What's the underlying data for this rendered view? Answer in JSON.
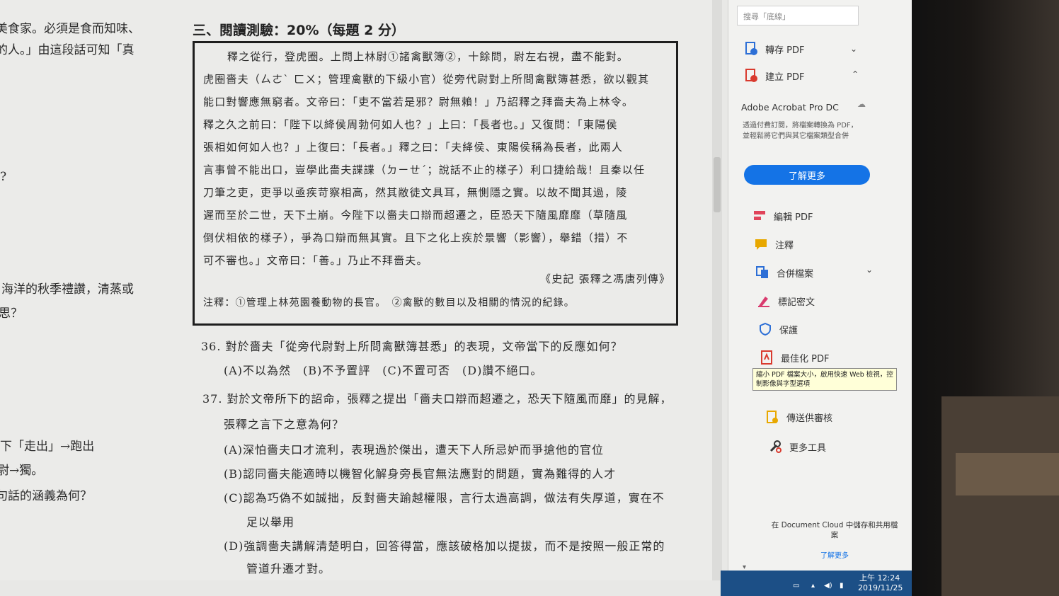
{
  "doc": {
    "left_fragments": [
      "美食家。必須是食而知味、",
      "的人。」由這段話可知「真",
      "?",
      "海洋的秋季禮讚，清蒸或",
      "思？",
      "下「走出」→跑出",
      "尉→獨。",
      "句話的涵義為何？"
    ],
    "section_heading": "三、閱讀測驗：20%（每題 2 分）",
    "passage_lines": [
      "釋之從行，登虎圈。上問上林尉①諸禽獸簿②，十餘問，尉左右視，盡不能對。",
      "虎圈嗇夫（ㄙㄜˋ ㄈㄨ；管理禽獸的下級小官）從旁代尉對上所問禽獸簿甚悉，欲以觀其",
      "能口對響應無窮者。文帝曰：「吏不當若是邪？尉無賴！」乃詔釋之拜嗇夫為上林令。",
      "釋之久之前曰：「陛下以絳侯周勃何如人也？」上曰：「長者也。」又復問：「東陽侯",
      "張相如何如人也？」上復曰：「長者。」釋之曰：「夫絳侯、東陽侯稱為長者，此兩人",
      "言事曾不能出口，豈學此嗇夫諜諜（ㄉㄧㄝˊ；說話不止的樣子）利口捷給哉！且秦以任",
      "刀筆之吏，吏爭以亟疾苛察相高，然其敝徒文具耳，無惻隱之實。以故不聞其過，陵",
      "遲而至於二世，天下土崩。今陛下以嗇夫口辯而超遷之，臣恐天下隨風靡靡（草隨風",
      "倒伏相依的樣子），爭為口辯而無其實。且下之化上疾於景響（影響），舉錯（措）不",
      "可不審也。」文帝曰：「善。」乃止不拜嗇夫。"
    ],
    "source": "《史記 張釋之馮唐列傳》",
    "notes": "注釋：①管理上林苑園養動物的長官。　②禽獸的數目以及相關的情況的紀錄。",
    "questions": [
      "36. 對於嗇夫「從旁代尉對上所問禽獸簿甚悉」的表現，文帝當下的反應如何？",
      "(A)不以為然　(B)不予置評　(C)不置可否　(D)讚不絕口。",
      "37. 對於文帝所下的詔命，張釋之提出「嗇夫口辯而超遷之，恐天下隨風而靡」的見解，",
      "張釋之言下之意為何？",
      "(A)深怕嗇夫口才流利，表現過於傑出，遭天下人所忌妒而爭搶他的官位",
      "(B)認同嗇夫能適時以機智化解身旁長官無法應對的問題，實為難得的人才",
      "(C)認為巧偽不如誠拙，反對嗇夫踰越權限，言行太過高調，做法有失厚道，實在不",
      "足以舉用",
      "(D)強調嗇夫講解清楚明白，回答得當，應該破格加以提拔，而不是按照一般正常的",
      "管道升遷才對。"
    ]
  },
  "panel": {
    "search_placeholder": "搜尋「底線」",
    "tools_top": [
      {
        "label": "轉存 PDF",
        "icon": "export-pdf-icon",
        "color": "#2d6fd6"
      },
      {
        "label": "建立 PDF",
        "icon": "create-pdf-icon",
        "color": "#d93a2e"
      }
    ],
    "acrobat_title": "Adobe Acrobat Pro DC",
    "acrobat_desc": "透過付費訂閱，將檔案轉換為 PDF，並輕鬆將它們與其它檔案類型合併",
    "learn_more": "了解更多",
    "tools": [
      {
        "label": "編輯 PDF",
        "icon": "edit-pdf-icon",
        "color": "#e0445a"
      },
      {
        "label": "注釋",
        "icon": "comment-icon",
        "color": "#e8a800"
      },
      {
        "label": "合併檔案",
        "icon": "combine-files-icon",
        "color": "#2d6fd6"
      },
      {
        "label": "標記密文",
        "icon": "redact-icon",
        "color": "#d93a6e"
      },
      {
        "label": "保護",
        "icon": "protect-shield-icon",
        "color": "#2d6fd6"
      },
      {
        "label": "最佳化 PDF",
        "icon": "optimize-pdf-icon",
        "color": "#d93a2e"
      },
      {
        "label": "傳送供審核",
        "icon": "send-review-icon",
        "color": "#e8a800"
      },
      {
        "label": "更多工具",
        "icon": "more-tools-icon",
        "color": "#333333"
      }
    ],
    "tooltip": "縮小 PDF 檔案大小，啟用快速 Web 檢視，控制影像與字型選項",
    "cloud_text": "在 Document Cloud 中儲存和共用檔案",
    "cloud_link": "了解更多"
  },
  "taskbar": {
    "time": "上午 12:24",
    "date": "2019/11/25"
  }
}
